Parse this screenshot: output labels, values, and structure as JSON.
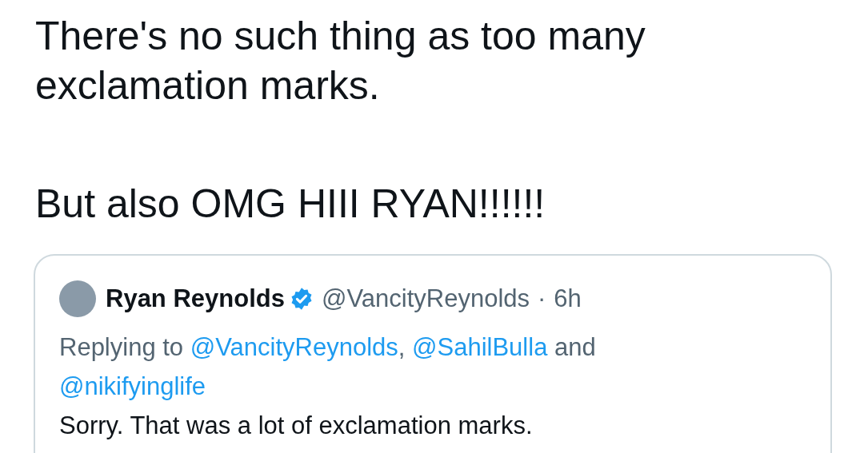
{
  "tweet": {
    "paragraphs": [
      "There's no such thing as too many exclamation marks.",
      "But also OMG HIII RYAN!!!!!!"
    ]
  },
  "quoted_tweet": {
    "author": {
      "name": "Ryan Reynolds",
      "verified": true,
      "handle": "@VancityReynolds",
      "separator": "·",
      "time": "6h"
    },
    "reply_context": [
      {
        "kind": "text",
        "text": "Replying to "
      },
      {
        "kind": "link",
        "text": "@VancityReynolds"
      },
      {
        "kind": "text",
        "text": ", "
      },
      {
        "kind": "link",
        "text": "@SahilBulla"
      },
      {
        "kind": "text",
        "text": " and "
      },
      {
        "kind": "link",
        "text": "@nikifyinglife"
      }
    ],
    "text": "Sorry. That was a lot of exclamation marks."
  }
}
